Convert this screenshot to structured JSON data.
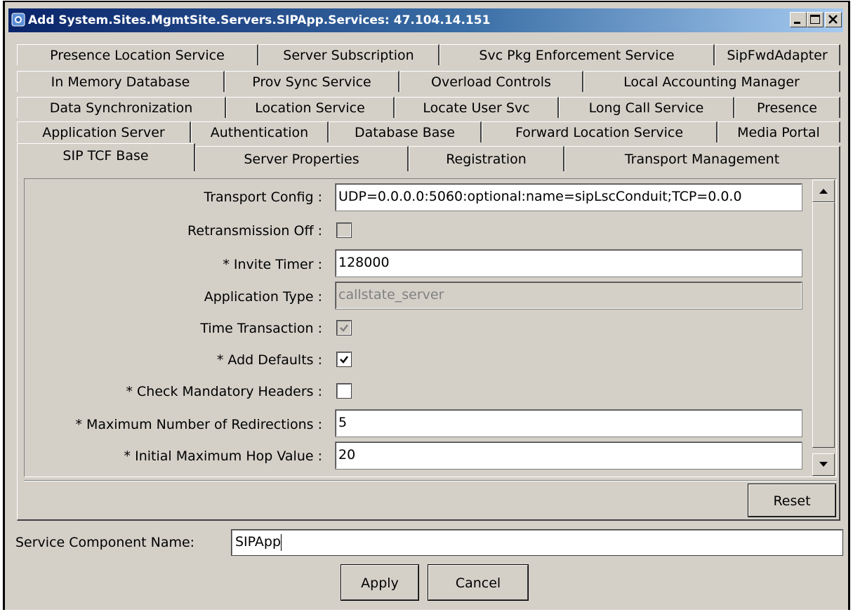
{
  "window": {
    "title": "Add System.Sites.MgmtSite.Servers.SIPApp.Services: 47.104.14.151",
    "icon": "app-icon",
    "controls": [
      "minimize-icon",
      "maximize-icon",
      "close-icon"
    ]
  },
  "tabs": {
    "row1": [
      "Presence Location Service",
      "Server Subscription",
      "Svc Pkg Enforcement Service",
      "SipFwdAdapter"
    ],
    "row2": [
      "In Memory Database",
      "Prov Sync Service",
      "Overload Controls",
      "Local Accounting Manager"
    ],
    "row3": [
      "Data Synchronization",
      "Location Service",
      "Locate User Svc",
      "Long Call Service",
      "Presence"
    ],
    "row4": [
      "Application Server",
      "Authentication",
      "Database Base",
      "Forward Location Service",
      "Media Portal"
    ],
    "row5": [
      "SIP TCF Base",
      "Server Properties",
      "Registration",
      "Transport Management"
    ],
    "selected": "SIP TCF Base"
  },
  "form": {
    "transport_config": {
      "label": "Transport Config :",
      "value": "UDP=0.0.0.0:5060:optional:name=sipLscConduit;TCP=0.0.0"
    },
    "retransmission_off": {
      "label": "Retransmission Off :",
      "checked": false,
      "enabled": false
    },
    "invite_timer": {
      "label": "* Invite Timer :",
      "value": "128000"
    },
    "application_type": {
      "label": "Application Type :",
      "value": "callstate_server",
      "enabled": false
    },
    "time_transaction": {
      "label": "Time Transaction :",
      "checked": true,
      "enabled": false
    },
    "add_defaults": {
      "label": "* Add Defaults :",
      "checked": true
    },
    "check_mandatory_headers": {
      "label": "* Check Mandatory Headers :",
      "checked": false
    },
    "max_redirections": {
      "label": "* Maximum Number of Redirections :",
      "value": "5"
    },
    "initial_max_hop": {
      "label": "* Initial Maximum Hop Value :",
      "value": "20"
    }
  },
  "reset_label": "Reset",
  "service_component": {
    "label": "Service Component Name:",
    "value": "SIPApp"
  },
  "buttons": {
    "apply": "Apply",
    "cancel": "Cancel"
  },
  "colors": {
    "title_start": "#0a246a",
    "title_end": "#a6caf0",
    "face": "#d4d0c8"
  }
}
